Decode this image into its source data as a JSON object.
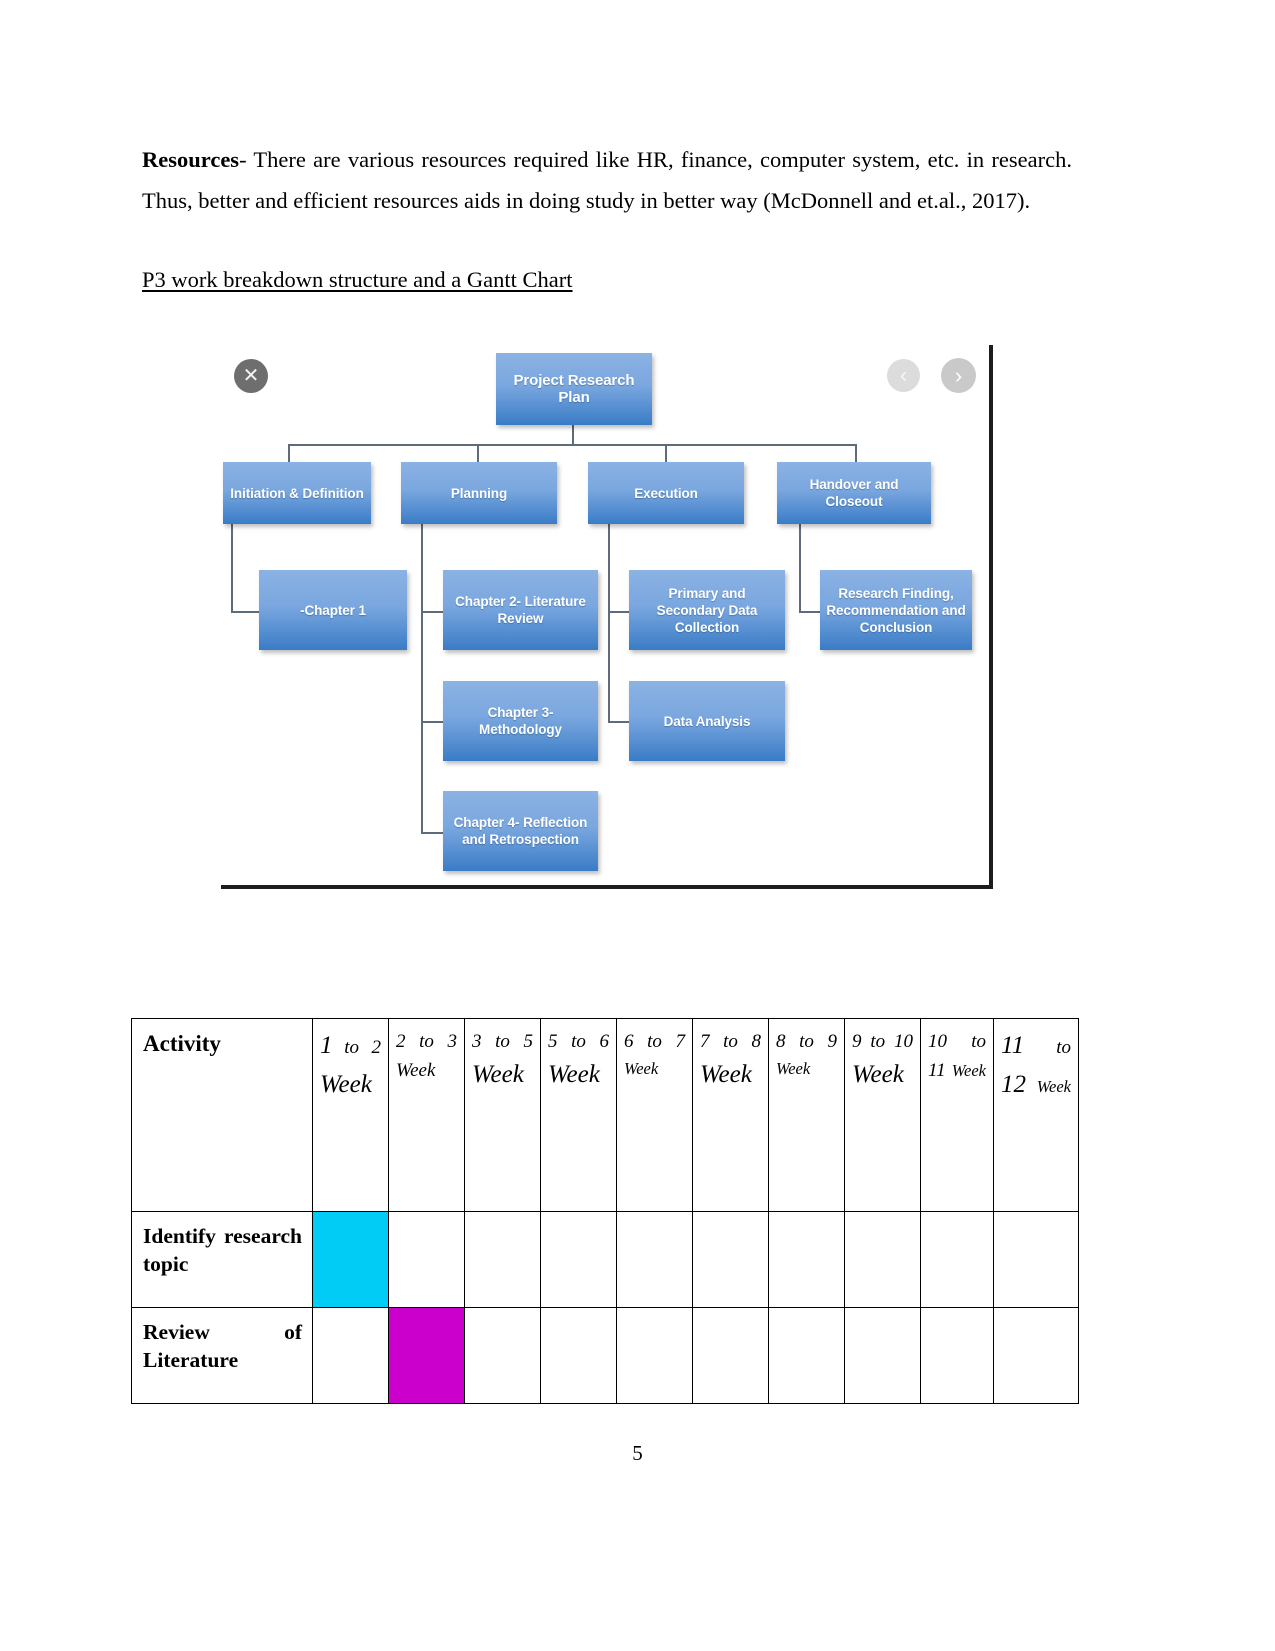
{
  "document": {
    "page_number": "5",
    "paragraph": {
      "lead": "Resources",
      "body": "- There are various resources required like HR, finance, computer system, etc. in research. Thus, better and efficient resources aids in doing study in better way (McDonnell and et.al., 2017)."
    },
    "section_heading": "P3 work breakdown structure and a Gantt Chart"
  },
  "wbs": {
    "controls": {
      "close_label": "✕",
      "prev_label": "‹",
      "next_label": "›"
    },
    "root": "Project Research Plan",
    "level1": [
      "Initiation & Definition",
      "Planning",
      "Execution",
      "Handover and Closeout"
    ],
    "level2": [
      "-Chapter 1",
      "Chapter 2- Literature Review",
      "Chapter 3- Methodology",
      "Chapter 4- Reflection and Retrospection",
      "Primary and Secondary Data Collection",
      "Data Analysis",
      "Research Finding, Recommendation and Conclusion"
    ],
    "colors": {
      "box_top": "#8bb2e3",
      "box_bottom": "#3a7cc7",
      "connector": "#5d6b7a"
    }
  },
  "gantt": {
    "colors": {
      "cyan": "#00CCF5",
      "magenta": "#CC00CC",
      "border": "#000000"
    },
    "columns": [
      "Activity",
      "1 to 2 Week",
      "2 to 3 Week",
      "3 to 5 Week",
      "5 to 6 Week",
      "6 to 7 Week",
      "7 to 8 Week",
      "8 to 9 Week",
      "9 to 10 Week",
      "10 to 11 Week",
      "11 to 12 Week"
    ],
    "header_parts": [
      {
        "a": "1",
        "b": "to  2",
        "c": "Week"
      },
      {
        "a": "2  to  3",
        "b": "Week"
      },
      {
        "a": "3  to  5",
        "b": "Week"
      },
      {
        "a": "5 to 6",
        "b": "Week"
      },
      {
        "a": "6  to  7",
        "b": "Week"
      },
      {
        "a": "7 to 8",
        "b": "Week"
      },
      {
        "a": "8  to  9",
        "b": "Week"
      },
      {
        "a": "9 to 10",
        "b": "Week"
      },
      {
        "a": "10",
        "b": "to",
        "c": "11",
        "d": "Week"
      },
      {
        "a": "11",
        "b": "to",
        "c": "12",
        "d": "Week"
      }
    ],
    "rows": [
      {
        "activity": "Identify research topic",
        "cells": [
          "cyan",
          "",
          "",
          "",
          "",
          "",
          "",
          "",
          "",
          ""
        ]
      },
      {
        "activity": "Review of Literature",
        "cells": [
          "",
          "magenta",
          "",
          "",
          "",
          "",
          "",
          "",
          "",
          ""
        ]
      }
    ]
  }
}
